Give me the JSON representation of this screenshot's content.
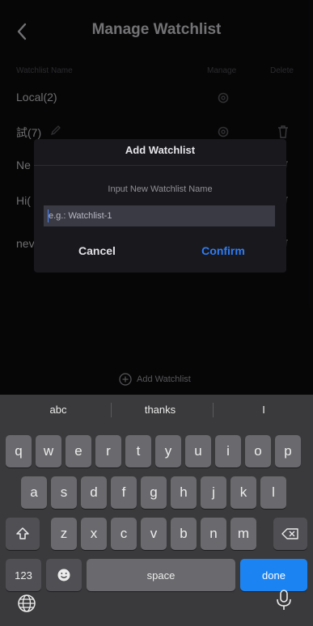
{
  "header": {
    "title": "Manage Watchlist"
  },
  "columns": {
    "name": "Watchlist Name",
    "manage": "Manage",
    "delete": "Delete"
  },
  "watchlists": [
    {
      "name": "Local(2)"
    },
    {
      "name": "試(7)"
    },
    {
      "name": "Ne"
    },
    {
      "name": "Hi("
    },
    {
      "name": "nev"
    }
  ],
  "add_watchlist_label": "Add Watchlist",
  "dialog": {
    "title": "Add Watchlist",
    "subtitle": "Input New Watchlist Name",
    "input_value": "",
    "input_placeholder": "e.g.: Watchlist-1",
    "cancel_label": "Cancel",
    "confirm_label": "Confirm"
  },
  "keyboard": {
    "suggestions": [
      "abc",
      "thanks",
      "I"
    ],
    "row1": [
      "q",
      "w",
      "e",
      "r",
      "t",
      "y",
      "u",
      "i",
      "o",
      "p"
    ],
    "row2": [
      "a",
      "s",
      "d",
      "f",
      "g",
      "h",
      "j",
      "k",
      "l"
    ],
    "row3": [
      "z",
      "x",
      "c",
      "v",
      "b",
      "n",
      "m"
    ],
    "numbers_label": "123",
    "space_label": "space",
    "done_label": "done"
  },
  "colors": {
    "accent": "#2f7cf6",
    "done_key": "#1c84f2",
    "key": "#6a6a6e",
    "keyboard_bg": "#3a3a3c"
  }
}
